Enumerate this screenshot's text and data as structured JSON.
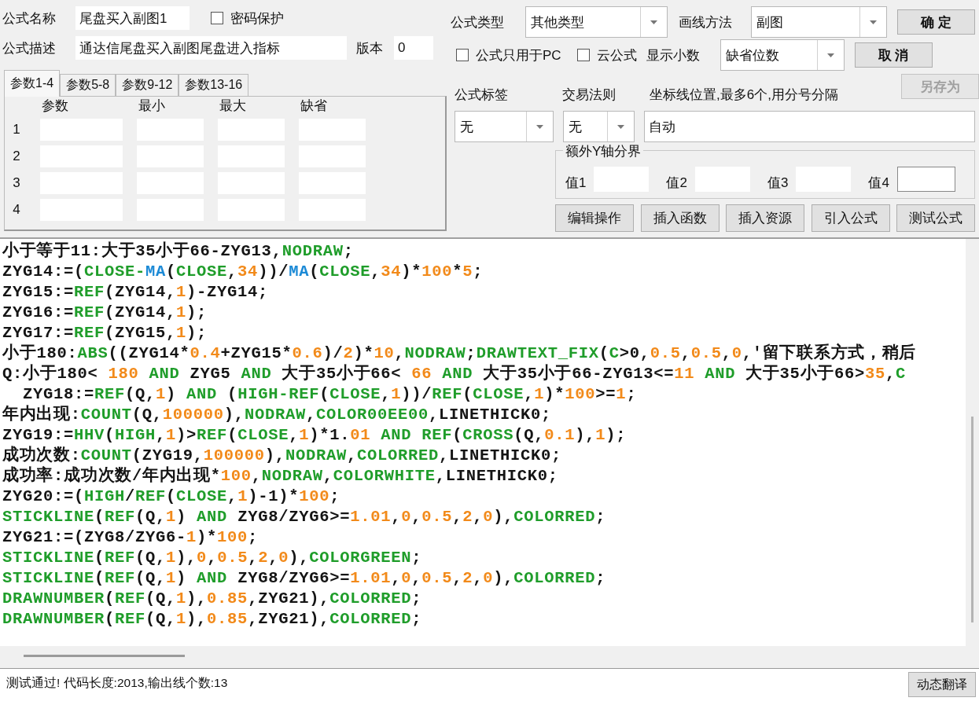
{
  "form": {
    "name_label": "公式名称",
    "name_value": "尾盘买入副图1",
    "password": {
      "label": "密码保护",
      "checked": false
    },
    "description_label": "公式描述",
    "description_value": "通达信尾盘买入副图尾盘进入指标",
    "version_label": "版本",
    "version_value": "0",
    "type_label": "公式类型",
    "type_value": "其他类型",
    "draw_method_label": "画线方法",
    "draw_method_value": "副图",
    "options": [
      {
        "label": "公式只用于PC",
        "checked": false
      },
      {
        "label": "云公式",
        "checked": false
      }
    ],
    "decimals_label": "显示小数",
    "decimals_value": "缺省位数",
    "tag_label": "公式标签",
    "tag_value": "无",
    "trade_rule_label": "交易法则",
    "trade_rule_value": "无",
    "axis_label": "坐标线位置,最多6个,用分号分隔",
    "axis_value": "自动",
    "y_bounds": {
      "title": "额外Y轴分界",
      "values": [
        "值1",
        "值2",
        "值3",
        "值4"
      ]
    }
  },
  "side_buttons": [
    {
      "label": "确 定",
      "disabled": false
    },
    {
      "label": "取 消",
      "disabled": false
    },
    {
      "label": "另存为",
      "disabled": true
    }
  ],
  "params": {
    "tabs": [
      {
        "label": "参数1-4",
        "selected": true
      },
      {
        "label": "参数5-8",
        "selected": false
      },
      {
        "label": "参数9-12",
        "selected": false
      },
      {
        "label": "参数13-16",
        "selected": false
      }
    ],
    "columns": [
      "参数",
      "最小",
      "最大",
      "缺省"
    ],
    "rows": [
      "1",
      "2",
      "3",
      "4"
    ]
  },
  "tool_buttons": [
    "编辑操作",
    "插入函数",
    "插入资源",
    "引入公式",
    "测试公式"
  ],
  "code": [
    {
      "segments": [
        {
          "kind": "plain",
          "text": "小于等于11:大于35小于66-ZYG13,"
        },
        {
          "kind": "keyword",
          "text": "NODRAW"
        },
        {
          "kind": "plain",
          "text": ";"
        }
      ]
    },
    {
      "segments": [
        {
          "kind": "plain",
          "text": "ZYG14:=("
        },
        {
          "kind": "keyword",
          "text": "CLOSE-"
        },
        {
          "kind": "function",
          "text": "MA"
        },
        {
          "kind": "plain",
          "text": "("
        },
        {
          "kind": "keyword",
          "text": "CLOSE"
        },
        {
          "kind": "plain",
          "text": ","
        },
        {
          "kind": "number",
          "text": "34"
        },
        {
          "kind": "plain",
          "text": "))/"
        },
        {
          "kind": "function",
          "text": "MA"
        },
        {
          "kind": "plain",
          "text": "("
        },
        {
          "kind": "keyword",
          "text": "CLOSE"
        },
        {
          "kind": "plain",
          "text": ","
        },
        {
          "kind": "number",
          "text": "34"
        },
        {
          "kind": "plain",
          "text": ")*"
        },
        {
          "kind": "number",
          "text": "100"
        },
        {
          "kind": "plain",
          "text": "*"
        },
        {
          "kind": "number",
          "text": "5"
        },
        {
          "kind": "plain",
          "text": ";"
        }
      ]
    },
    {
      "segments": [
        {
          "kind": "plain",
          "text": "ZYG15:="
        },
        {
          "kind": "keyword",
          "text": "REF"
        },
        {
          "kind": "plain",
          "text": "(ZYG14,"
        },
        {
          "kind": "number",
          "text": "1"
        },
        {
          "kind": "plain",
          "text": ")-ZYG14;"
        }
      ]
    },
    {
      "segments": [
        {
          "kind": "plain",
          "text": "ZYG16:="
        },
        {
          "kind": "keyword",
          "text": "REF"
        },
        {
          "kind": "plain",
          "text": "(ZYG14,"
        },
        {
          "kind": "number",
          "text": "1"
        },
        {
          "kind": "plain",
          "text": ");"
        }
      ]
    },
    {
      "segments": [
        {
          "kind": "plain",
          "text": "ZYG17:="
        },
        {
          "kind": "keyword",
          "text": "REF"
        },
        {
          "kind": "plain",
          "text": "(ZYG15,"
        },
        {
          "kind": "number",
          "text": "1"
        },
        {
          "kind": "plain",
          "text": ");"
        }
      ]
    },
    {
      "segments": [
        {
          "kind": "plain",
          "text": "小于180:"
        },
        {
          "kind": "keyword",
          "text": "ABS"
        },
        {
          "kind": "plain",
          "text": "((ZYG14*"
        },
        {
          "kind": "number",
          "text": "0.4"
        },
        {
          "kind": "plain",
          "text": "+ZYG15*"
        },
        {
          "kind": "number",
          "text": "0.6"
        },
        {
          "kind": "plain",
          "text": ")/"
        },
        {
          "kind": "number",
          "text": "2"
        },
        {
          "kind": "plain",
          "text": ")*"
        },
        {
          "kind": "number",
          "text": "10"
        },
        {
          "kind": "plain",
          "text": ","
        },
        {
          "kind": "keyword",
          "text": "NODRAW"
        },
        {
          "kind": "plain",
          "text": ";"
        },
        {
          "kind": "keyword",
          "text": "DRAWTEXT_FIX"
        },
        {
          "kind": "plain",
          "text": "("
        },
        {
          "kind": "keyword",
          "text": "C"
        },
        {
          "kind": "plain",
          "text": ">0,"
        },
        {
          "kind": "number",
          "text": "0.5"
        },
        {
          "kind": "plain",
          "text": ","
        },
        {
          "kind": "number",
          "text": "0.5"
        },
        {
          "kind": "plain",
          "text": ","
        },
        {
          "kind": "number",
          "text": "0"
        },
        {
          "kind": "plain",
          "text": ",'留下联系方式，稍后"
        }
      ]
    },
    {
      "segments": [
        {
          "kind": "plain",
          "text": "Q:小于180< "
        },
        {
          "kind": "number",
          "text": "180"
        },
        {
          "kind": "keyword",
          "text": " AND"
        },
        {
          "kind": "plain",
          "text": " ZYG5 "
        },
        {
          "kind": "keyword",
          "text": "AND"
        },
        {
          "kind": "plain",
          "text": " 大于35小于66< "
        },
        {
          "kind": "number",
          "text": "66"
        },
        {
          "kind": "keyword",
          "text": " AND"
        },
        {
          "kind": "plain",
          "text": " 大于35小于66-ZYG13<="
        },
        {
          "kind": "number",
          "text": "11"
        },
        {
          "kind": "keyword",
          "text": " AND"
        },
        {
          "kind": "plain",
          "text": " 大于35小于66>"
        },
        {
          "kind": "number",
          "text": "35"
        },
        {
          "kind": "plain",
          "text": ","
        },
        {
          "kind": "keyword",
          "text": "C"
        }
      ]
    },
    {
      "segments": [
        {
          "kind": "plain",
          "text": "  ZYG18:="
        },
        {
          "kind": "keyword",
          "text": "REF"
        },
        {
          "kind": "plain",
          "text": "(Q,"
        },
        {
          "kind": "number",
          "text": "1"
        },
        {
          "kind": "plain",
          "text": ") "
        },
        {
          "kind": "keyword",
          "text": "AND"
        },
        {
          "kind": "plain",
          "text": " ("
        },
        {
          "kind": "keyword",
          "text": "HIGH-REF"
        },
        {
          "kind": "plain",
          "text": "("
        },
        {
          "kind": "keyword",
          "text": "CLOSE"
        },
        {
          "kind": "plain",
          "text": ","
        },
        {
          "kind": "number",
          "text": "1"
        },
        {
          "kind": "plain",
          "text": "))/"
        },
        {
          "kind": "keyword",
          "text": "REF"
        },
        {
          "kind": "plain",
          "text": "("
        },
        {
          "kind": "keyword",
          "text": "CLOSE"
        },
        {
          "kind": "plain",
          "text": ","
        },
        {
          "kind": "number",
          "text": "1"
        },
        {
          "kind": "plain",
          "text": ")*"
        },
        {
          "kind": "number",
          "text": "100"
        },
        {
          "kind": "plain",
          "text": ">="
        },
        {
          "kind": "number",
          "text": "1"
        },
        {
          "kind": "plain",
          "text": ";"
        }
      ]
    },
    {
      "segments": [
        {
          "kind": "plain",
          "text": "年内出现:"
        },
        {
          "kind": "keyword",
          "text": "COUNT"
        },
        {
          "kind": "plain",
          "text": "(Q,"
        },
        {
          "kind": "number",
          "text": "100000"
        },
        {
          "kind": "plain",
          "text": "),"
        },
        {
          "kind": "keyword",
          "text": "NODRAW"
        },
        {
          "kind": "plain",
          "text": ","
        },
        {
          "kind": "keyword",
          "text": "COLOR00EE00"
        },
        {
          "kind": "plain",
          "text": ",LINETHICK0;"
        }
      ]
    },
    {
      "segments": [
        {
          "kind": "plain",
          "text": "ZYG19:="
        },
        {
          "kind": "keyword",
          "text": "HHV"
        },
        {
          "kind": "plain",
          "text": "("
        },
        {
          "kind": "keyword",
          "text": "HIGH"
        },
        {
          "kind": "plain",
          "text": ","
        },
        {
          "kind": "number",
          "text": "1"
        },
        {
          "kind": "plain",
          "text": ")>"
        },
        {
          "kind": "keyword",
          "text": "REF"
        },
        {
          "kind": "plain",
          "text": "("
        },
        {
          "kind": "keyword",
          "text": "CLOSE"
        },
        {
          "kind": "plain",
          "text": ","
        },
        {
          "kind": "number",
          "text": "1"
        },
        {
          "kind": "plain",
          "text": ")*1."
        },
        {
          "kind": "number",
          "text": "01"
        },
        {
          "kind": "keyword",
          "text": " AND REF"
        },
        {
          "kind": "plain",
          "text": "("
        },
        {
          "kind": "keyword",
          "text": "CROSS"
        },
        {
          "kind": "plain",
          "text": "(Q,"
        },
        {
          "kind": "number",
          "text": "0.1"
        },
        {
          "kind": "plain",
          "text": "),"
        },
        {
          "kind": "number",
          "text": "1"
        },
        {
          "kind": "plain",
          "text": ");"
        }
      ]
    },
    {
      "segments": [
        {
          "kind": "plain",
          "text": "成功次数:"
        },
        {
          "kind": "keyword",
          "text": "COUNT"
        },
        {
          "kind": "plain",
          "text": "(ZYG19,"
        },
        {
          "kind": "number",
          "text": "100000"
        },
        {
          "kind": "plain",
          "text": "),"
        },
        {
          "kind": "keyword",
          "text": "NODRAW"
        },
        {
          "kind": "plain",
          "text": ","
        },
        {
          "kind": "keyword",
          "text": "COLORRED"
        },
        {
          "kind": "plain",
          "text": ",LINETHICK0;"
        }
      ]
    },
    {
      "segments": [
        {
          "kind": "plain",
          "text": "成功率:成功次数/年内出现*"
        },
        {
          "kind": "number",
          "text": "100"
        },
        {
          "kind": "plain",
          "text": ","
        },
        {
          "kind": "keyword",
          "text": "NODRAW"
        },
        {
          "kind": "plain",
          "text": ","
        },
        {
          "kind": "keyword",
          "text": "COLORWHITE"
        },
        {
          "kind": "plain",
          "text": ",LINETHICK0;"
        }
      ]
    },
    {
      "segments": [
        {
          "kind": "plain",
          "text": "ZYG20:=("
        },
        {
          "kind": "keyword",
          "text": "HIGH"
        },
        {
          "kind": "plain",
          "text": "/"
        },
        {
          "kind": "keyword",
          "text": "REF"
        },
        {
          "kind": "plain",
          "text": "("
        },
        {
          "kind": "keyword",
          "text": "CLOSE"
        },
        {
          "kind": "plain",
          "text": ","
        },
        {
          "kind": "number",
          "text": "1"
        },
        {
          "kind": "plain",
          "text": ")-1)*"
        },
        {
          "kind": "number",
          "text": "100"
        },
        {
          "kind": "plain",
          "text": ";"
        }
      ]
    },
    {
      "segments": [
        {
          "kind": "keyword",
          "text": "STICKLINE"
        },
        {
          "kind": "plain",
          "text": "("
        },
        {
          "kind": "keyword",
          "text": "REF"
        },
        {
          "kind": "plain",
          "text": "(Q,"
        },
        {
          "kind": "number",
          "text": "1"
        },
        {
          "kind": "plain",
          "text": ") "
        },
        {
          "kind": "keyword",
          "text": "AND"
        },
        {
          "kind": "plain",
          "text": " ZYG8/ZYG6>="
        },
        {
          "kind": "number",
          "text": "1.01"
        },
        {
          "kind": "plain",
          "text": ","
        },
        {
          "kind": "number",
          "text": "0"
        },
        {
          "kind": "plain",
          "text": ","
        },
        {
          "kind": "number",
          "text": "0.5"
        },
        {
          "kind": "plain",
          "text": ","
        },
        {
          "kind": "number",
          "text": "2"
        },
        {
          "kind": "plain",
          "text": ","
        },
        {
          "kind": "number",
          "text": "0"
        },
        {
          "kind": "plain",
          "text": "),"
        },
        {
          "kind": "keyword",
          "text": "COLORRED"
        },
        {
          "kind": "plain",
          "text": ";"
        }
      ]
    },
    {
      "segments": [
        {
          "kind": "plain",
          "text": "ZYG21:=(ZYG8/ZYG6-"
        },
        {
          "kind": "number",
          "text": "1"
        },
        {
          "kind": "plain",
          "text": ")*"
        },
        {
          "kind": "number",
          "text": "100"
        },
        {
          "kind": "plain",
          "text": ";"
        }
      ]
    },
    {
      "segments": [
        {
          "kind": "keyword",
          "text": "STICKLINE"
        },
        {
          "kind": "plain",
          "text": "("
        },
        {
          "kind": "keyword",
          "text": "REF"
        },
        {
          "kind": "plain",
          "text": "(Q,"
        },
        {
          "kind": "number",
          "text": "1"
        },
        {
          "kind": "plain",
          "text": "),"
        },
        {
          "kind": "number",
          "text": "0"
        },
        {
          "kind": "plain",
          "text": ","
        },
        {
          "kind": "number",
          "text": "0.5"
        },
        {
          "kind": "plain",
          "text": ","
        },
        {
          "kind": "number",
          "text": "2"
        },
        {
          "kind": "plain",
          "text": ","
        },
        {
          "kind": "number",
          "text": "0"
        },
        {
          "kind": "plain",
          "text": "),"
        },
        {
          "kind": "keyword",
          "text": "COLORGREEN"
        },
        {
          "kind": "plain",
          "text": ";"
        }
      ]
    },
    {
      "segments": [
        {
          "kind": "keyword",
          "text": "STICKLINE"
        },
        {
          "kind": "plain",
          "text": "("
        },
        {
          "kind": "keyword",
          "text": "REF"
        },
        {
          "kind": "plain",
          "text": "(Q,"
        },
        {
          "kind": "number",
          "text": "1"
        },
        {
          "kind": "plain",
          "text": ") "
        },
        {
          "kind": "keyword",
          "text": "AND"
        },
        {
          "kind": "plain",
          "text": " ZYG8/ZYG6>="
        },
        {
          "kind": "number",
          "text": "1.01"
        },
        {
          "kind": "plain",
          "text": ","
        },
        {
          "kind": "number",
          "text": "0"
        },
        {
          "kind": "plain",
          "text": ","
        },
        {
          "kind": "number",
          "text": "0.5"
        },
        {
          "kind": "plain",
          "text": ","
        },
        {
          "kind": "number",
          "text": "2"
        },
        {
          "kind": "plain",
          "text": ","
        },
        {
          "kind": "number",
          "text": "0"
        },
        {
          "kind": "plain",
          "text": "),"
        },
        {
          "kind": "keyword",
          "text": "COLORRED"
        },
        {
          "kind": "plain",
          "text": ";"
        }
      ]
    },
    {
      "segments": [
        {
          "kind": "keyword",
          "text": "DRAWNUMBER"
        },
        {
          "kind": "plain",
          "text": "("
        },
        {
          "kind": "keyword",
          "text": "REF"
        },
        {
          "kind": "plain",
          "text": "(Q,"
        },
        {
          "kind": "number",
          "text": "1"
        },
        {
          "kind": "plain",
          "text": "),"
        },
        {
          "kind": "number",
          "text": "0.85"
        },
        {
          "kind": "plain",
          "text": ",ZYG21),"
        },
        {
          "kind": "keyword",
          "text": "COLORRED"
        },
        {
          "kind": "plain",
          "text": ";"
        }
      ]
    },
    {
      "segments": [
        {
          "kind": "keyword",
          "text": "DRAWNUMBER"
        },
        {
          "kind": "plain",
          "text": "("
        },
        {
          "kind": "keyword",
          "text": "REF"
        },
        {
          "kind": "plain",
          "text": "(Q,"
        },
        {
          "kind": "number",
          "text": "1"
        },
        {
          "kind": "plain",
          "text": "),"
        },
        {
          "kind": "number",
          "text": "0.85"
        },
        {
          "kind": "plain",
          "text": ",ZYG21),"
        },
        {
          "kind": "keyword",
          "text": "COLORRED"
        },
        {
          "kind": "plain",
          "text": ";"
        }
      ]
    }
  ],
  "status": {
    "message": "测试通过! 代码长度:2013,输出线个数:13",
    "button": "动态翻译"
  }
}
